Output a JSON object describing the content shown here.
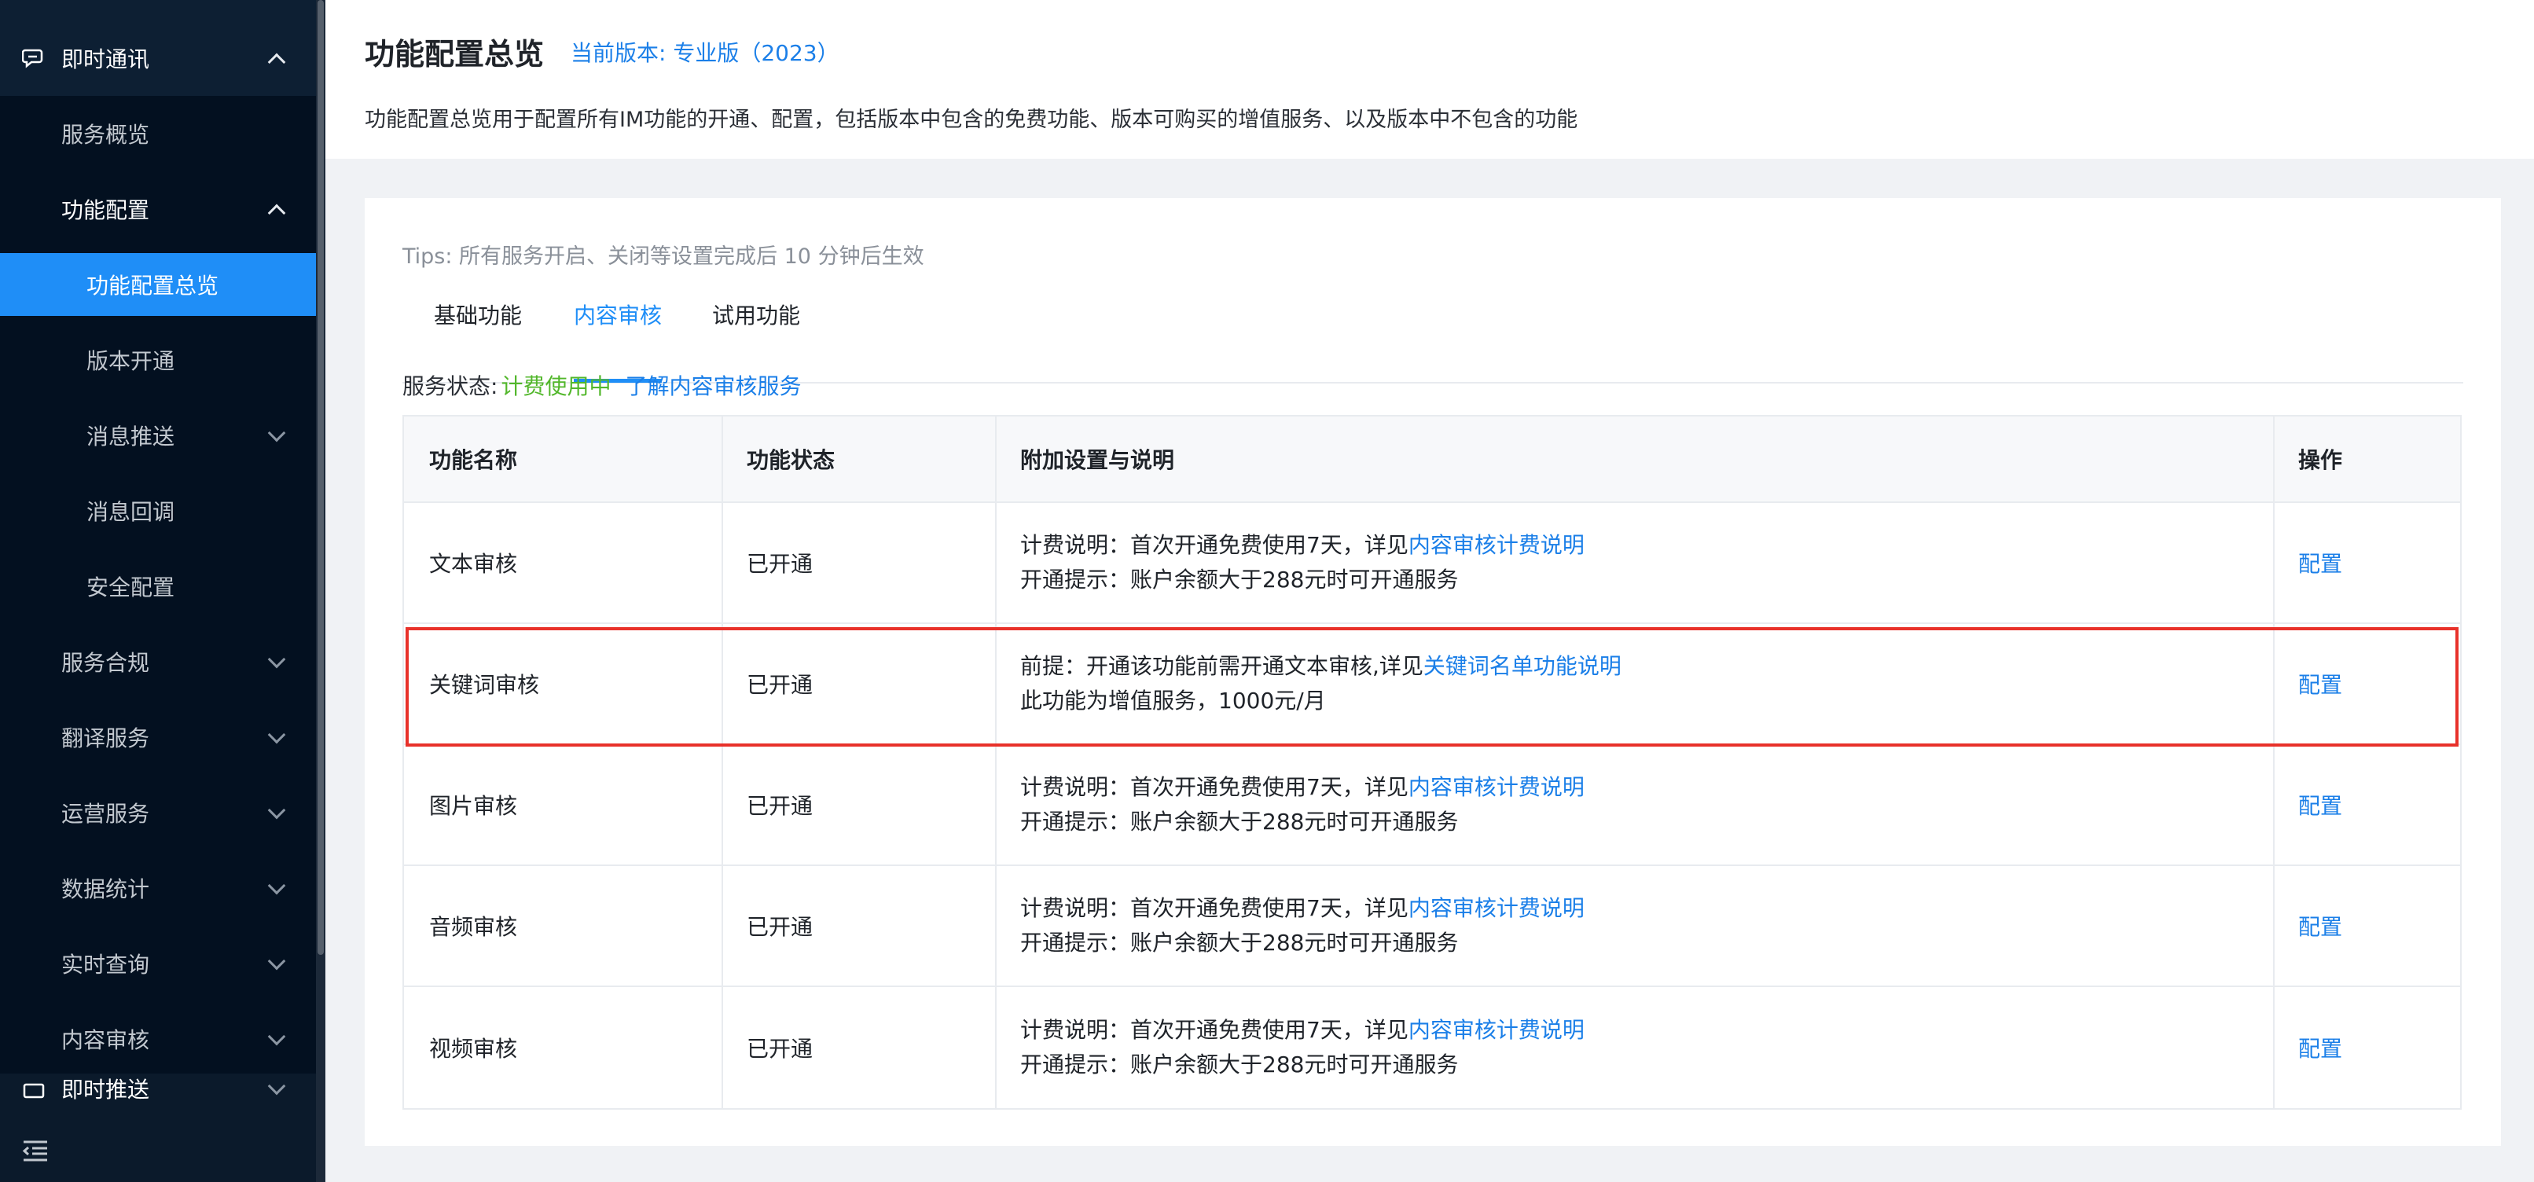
{
  "sidebar": {
    "top": {
      "label": "即时通讯"
    },
    "items": [
      {
        "label": "服务概览"
      },
      {
        "label": "功能配置"
      },
      {
        "label": "功能配置总览"
      },
      {
        "label": "版本开通"
      },
      {
        "label": "消息推送"
      },
      {
        "label": "消息回调"
      },
      {
        "label": "安全配置"
      },
      {
        "label": "服务合规"
      },
      {
        "label": "翻译服务"
      },
      {
        "label": "运营服务"
      },
      {
        "label": "数据统计"
      },
      {
        "label": "实时查询"
      },
      {
        "label": "内容审核"
      },
      {
        "label": "即时推送"
      }
    ]
  },
  "header": {
    "title": "功能配置总览",
    "version": "当前版本: 专业版（2023）",
    "description": "功能配置总览用于配置所有IM功能的开通、配置，包括版本中包含的免费功能、版本可购买的增值服务、以及版本中不包含的功能"
  },
  "tips": "Tips: 所有服务开启、关闭等设置完成后 10 分钟后生效",
  "tabs": [
    "基础功能",
    "内容审核",
    "试用功能"
  ],
  "active_tab": "内容审核",
  "service_status": {
    "label": "服务状态:",
    "value": "计费使用中",
    "link": "了解内容审核服务"
  },
  "table": {
    "headers": [
      "功能名称",
      "功能状态",
      "附加设置与说明",
      "操作"
    ],
    "rows": [
      {
        "name": "文本审核",
        "status": "已开通",
        "line1_prefix": "计费说明：首次开通免费使用7天，详见",
        "line1_link": "内容审核计费说明",
        "line2": "开通提示：账户余额大于288元时可开通服务",
        "action": "配置"
      },
      {
        "name": "关键词审核",
        "status": "已开通",
        "line1_prefix": "前提：开通该功能前需开通文本审核,详见",
        "line1_link": "关键词名单功能说明",
        "line2": "此功能为增值服务，1000元/月",
        "action": "配置"
      },
      {
        "name": "图片审核",
        "status": "已开通",
        "line1_prefix": "计费说明：首次开通免费使用7天，详见",
        "line1_link": "内容审核计费说明",
        "line2": "开通提示：账户余额大于288元时可开通服务",
        "action": "配置"
      },
      {
        "name": "音频审核",
        "status": "已开通",
        "line1_prefix": "计费说明：首次开通免费使用7天，详见",
        "line1_link": "内容审核计费说明",
        "line2": "开通提示：账户余额大于288元时可开通服务",
        "action": "配置"
      },
      {
        "name": "视频审核",
        "status": "已开通",
        "line1_prefix": "计费说明：首次开通免费使用7天，详见",
        "line1_link": "内容审核计费说明",
        "line2": "开通提示：账户余额大于288元时可开通服务",
        "action": "配置"
      }
    ]
  },
  "colors": {
    "accent": "#1f8ef7",
    "link": "#1b7fe8",
    "success": "#52b72b",
    "highlight": "#e8312a",
    "sidebar": "#0b1a2b"
  }
}
